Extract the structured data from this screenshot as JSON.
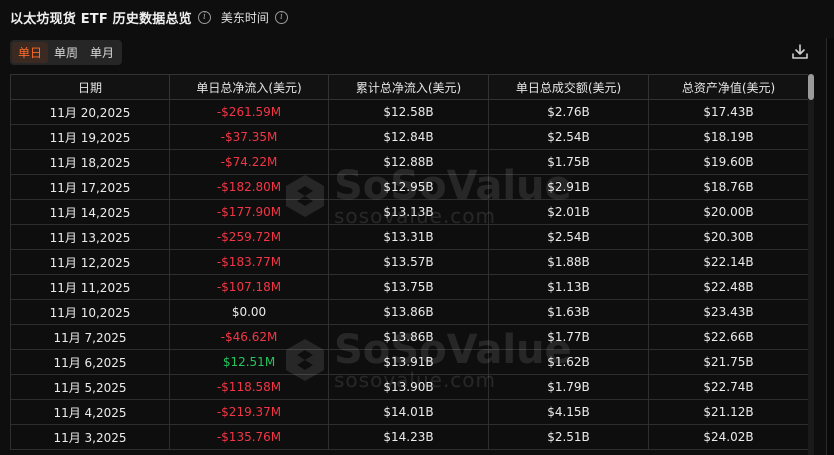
{
  "header": {
    "title": "以太坊现货 ETF 历史数据总览",
    "timezone_label": "美东时间"
  },
  "tabs": [
    {
      "label": "单日",
      "active": true
    },
    {
      "label": "单周",
      "active": false
    },
    {
      "label": "单月",
      "active": false
    }
  ],
  "table": {
    "columns": [
      "日期",
      "单日总净流入(美元)",
      "累计总净流入(美元)",
      "单日总成交额(美元)",
      "总资产净值(美元)"
    ],
    "rows": [
      {
        "date": "11月 20,2025",
        "daily_net_inflow": "-$261.59M",
        "cumulative_net_inflow": "$12.58B",
        "daily_volume": "$2.76B",
        "net_assets": "$17.43B",
        "sign": "neg"
      },
      {
        "date": "11月 19,2025",
        "daily_net_inflow": "-$37.35M",
        "cumulative_net_inflow": "$12.84B",
        "daily_volume": "$2.54B",
        "net_assets": "$18.19B",
        "sign": "neg"
      },
      {
        "date": "11月 18,2025",
        "daily_net_inflow": "-$74.22M",
        "cumulative_net_inflow": "$12.88B",
        "daily_volume": "$1.75B",
        "net_assets": "$19.60B",
        "sign": "neg"
      },
      {
        "date": "11月 17,2025",
        "daily_net_inflow": "-$182.80M",
        "cumulative_net_inflow": "$12.95B",
        "daily_volume": "$2.91B",
        "net_assets": "$18.76B",
        "sign": "neg"
      },
      {
        "date": "11月 14,2025",
        "daily_net_inflow": "-$177.90M",
        "cumulative_net_inflow": "$13.13B",
        "daily_volume": "$2.01B",
        "net_assets": "$20.00B",
        "sign": "neg"
      },
      {
        "date": "11月 13,2025",
        "daily_net_inflow": "-$259.72M",
        "cumulative_net_inflow": "$13.31B",
        "daily_volume": "$2.54B",
        "net_assets": "$20.30B",
        "sign": "neg"
      },
      {
        "date": "11月 12,2025",
        "daily_net_inflow": "-$183.77M",
        "cumulative_net_inflow": "$13.57B",
        "daily_volume": "$1.88B",
        "net_assets": "$22.14B",
        "sign": "neg"
      },
      {
        "date": "11月 11,2025",
        "daily_net_inflow": "-$107.18M",
        "cumulative_net_inflow": "$13.75B",
        "daily_volume": "$1.13B",
        "net_assets": "$22.48B",
        "sign": "neg"
      },
      {
        "date": "11月 10,2025",
        "daily_net_inflow": "$0.00",
        "cumulative_net_inflow": "$13.86B",
        "daily_volume": "$1.63B",
        "net_assets": "$23.43B",
        "sign": "zero"
      },
      {
        "date": "11月 7,2025",
        "daily_net_inflow": "-$46.62M",
        "cumulative_net_inflow": "$13.86B",
        "daily_volume": "$1.77B",
        "net_assets": "$22.66B",
        "sign": "neg"
      },
      {
        "date": "11月 6,2025",
        "daily_net_inflow": "$12.51M",
        "cumulative_net_inflow": "$13.91B",
        "daily_volume": "$1.62B",
        "net_assets": "$21.75B",
        "sign": "pos"
      },
      {
        "date": "11月 5,2025",
        "daily_net_inflow": "-$118.58M",
        "cumulative_net_inflow": "$13.90B",
        "daily_volume": "$1.79B",
        "net_assets": "$22.74B",
        "sign": "neg"
      },
      {
        "date": "11月 4,2025",
        "daily_net_inflow": "-$219.37M",
        "cumulative_net_inflow": "$14.01B",
        "daily_volume": "$4.15B",
        "net_assets": "$21.12B",
        "sign": "neg"
      },
      {
        "date": "11月 3,2025",
        "daily_net_inflow": "-$135.76M",
        "cumulative_net_inflow": "$14.23B",
        "daily_volume": "$2.51B",
        "net_assets": "$24.02B",
        "sign": "neg"
      }
    ]
  },
  "watermark": {
    "brand": "SoSoValue",
    "domain": "sosovalue.com"
  },
  "icons": {
    "info": "info-icon",
    "download": "download-icon"
  },
  "colors": {
    "negative": "#f23645",
    "positive": "#22c55e",
    "accent": "#ff6a2a"
  }
}
